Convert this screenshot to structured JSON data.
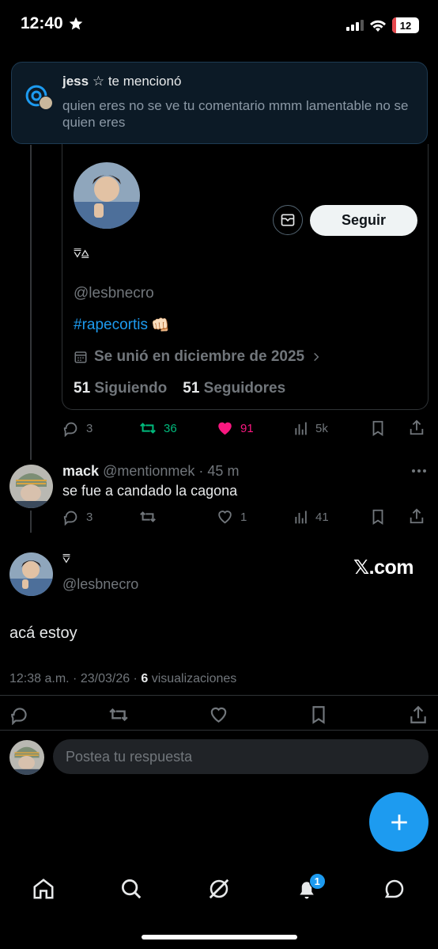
{
  "status_bar": {
    "time": "12:40",
    "battery": "12"
  },
  "notification": {
    "user": "jess",
    "star": "☆",
    "action": "te mencionó",
    "text": "quien eres no se ve tu comentario mmm lamentable no se quien eres"
  },
  "profile_card": {
    "name_glyph": "⩢⩠",
    "handle": "@lesbnecro",
    "hashtag": "#rapecortis",
    "hashtag_emoji": "👊🏻",
    "joined": "Se unió en diciembre de 2025",
    "following_count": "51",
    "following_label": "Siguiendo",
    "followers_count": "51",
    "followers_label": "Seguidores",
    "follow_button": "Seguir"
  },
  "quoted_actions": {
    "replies": "3",
    "reposts": "36",
    "likes": "91",
    "views": "5k"
  },
  "reply": {
    "name": "mack",
    "handle": "@mentionmek",
    "time": "45 m",
    "text": "se fue a candado la cagona",
    "replies": "3",
    "likes": "1",
    "views": "41"
  },
  "main_tweet": {
    "name_glyph": "⩢",
    "handle": "@lesbnecro",
    "watermark": "𝕏.com",
    "text": "acá estoy",
    "time": "12:38 a.m.",
    "date": "23/03/26",
    "views_count": "6",
    "views_label": "visualizaciones"
  },
  "composer": {
    "placeholder": "Postea tu respuesta"
  },
  "tabbar": {
    "notifications_badge": "1"
  },
  "colors": {
    "accent": "#1d9bf0",
    "repost": "#00ba7c",
    "like": "#f91880",
    "background": "#000000"
  }
}
